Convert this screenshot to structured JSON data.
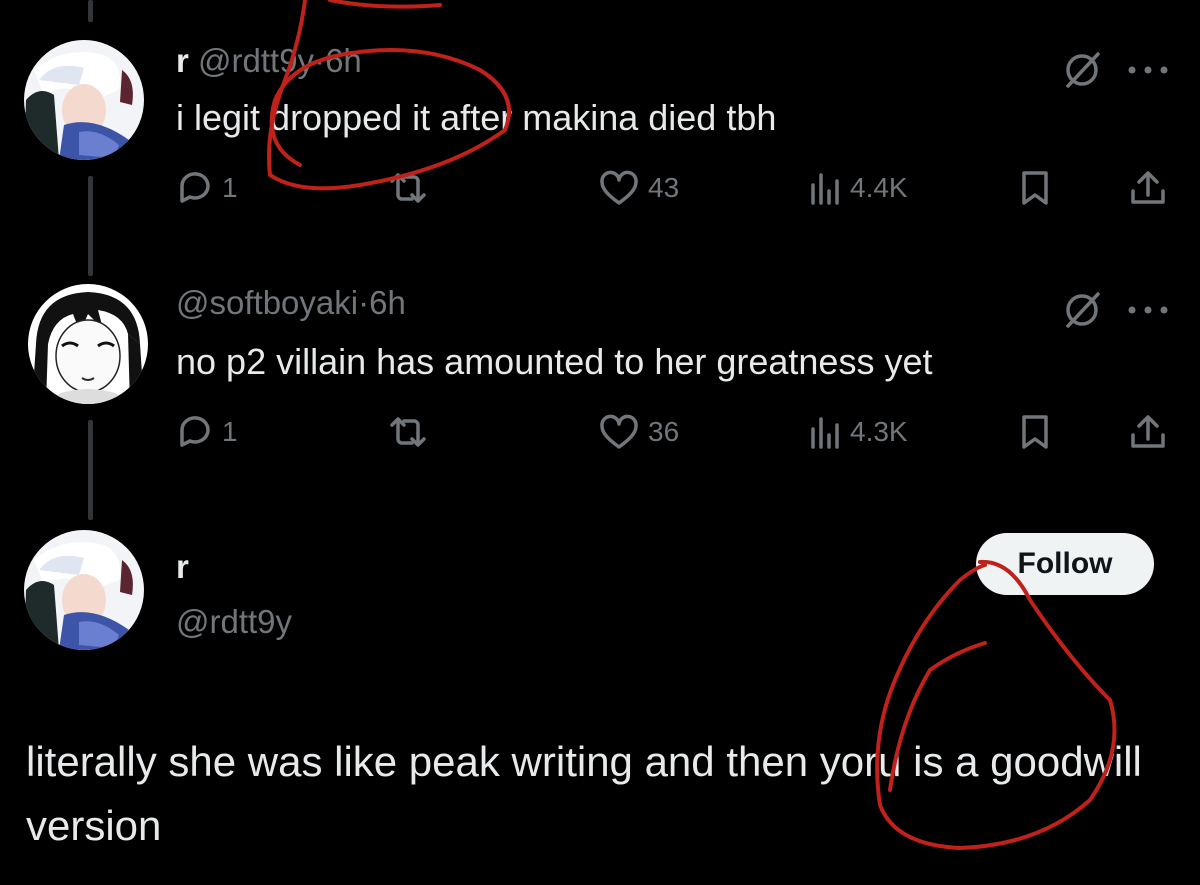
{
  "replies": [
    {
      "display_name": "r",
      "handle": "@rdtt9y",
      "separator": "·",
      "time": "6h",
      "text": "i legit dropped it after makina died tbh",
      "counts": {
        "replies": "1",
        "reposts": "",
        "likes": "43",
        "views": "4.4K"
      }
    },
    {
      "display_name": "",
      "handle": "@softboyaki",
      "separator": "·",
      "time": "6h",
      "text": "no p2 villain has amounted to her greatness yet",
      "counts": {
        "replies": "1",
        "reposts": "",
        "likes": "36",
        "views": "4.3K"
      }
    }
  ],
  "main_post": {
    "display_name": "r",
    "handle": "@rdtt9y",
    "follow_label": "Follow",
    "text": "literally she was like peak writing and then yoru is a goodwill version"
  },
  "icons": {
    "grok": "slashed-circle-icon",
    "more": "more-dots-icon",
    "reply": "speech-bubble-icon",
    "repost": "repost-arrows-icon",
    "like": "heart-icon",
    "views": "bar-chart-icon",
    "bookmark": "bookmark-icon",
    "share": "share-arrow-icon"
  },
  "colors": {
    "background": "#000000",
    "text": "#e7e9ea",
    "muted": "#71767b",
    "annotation": "#c0221b",
    "follow_bg": "#eff3f4"
  }
}
